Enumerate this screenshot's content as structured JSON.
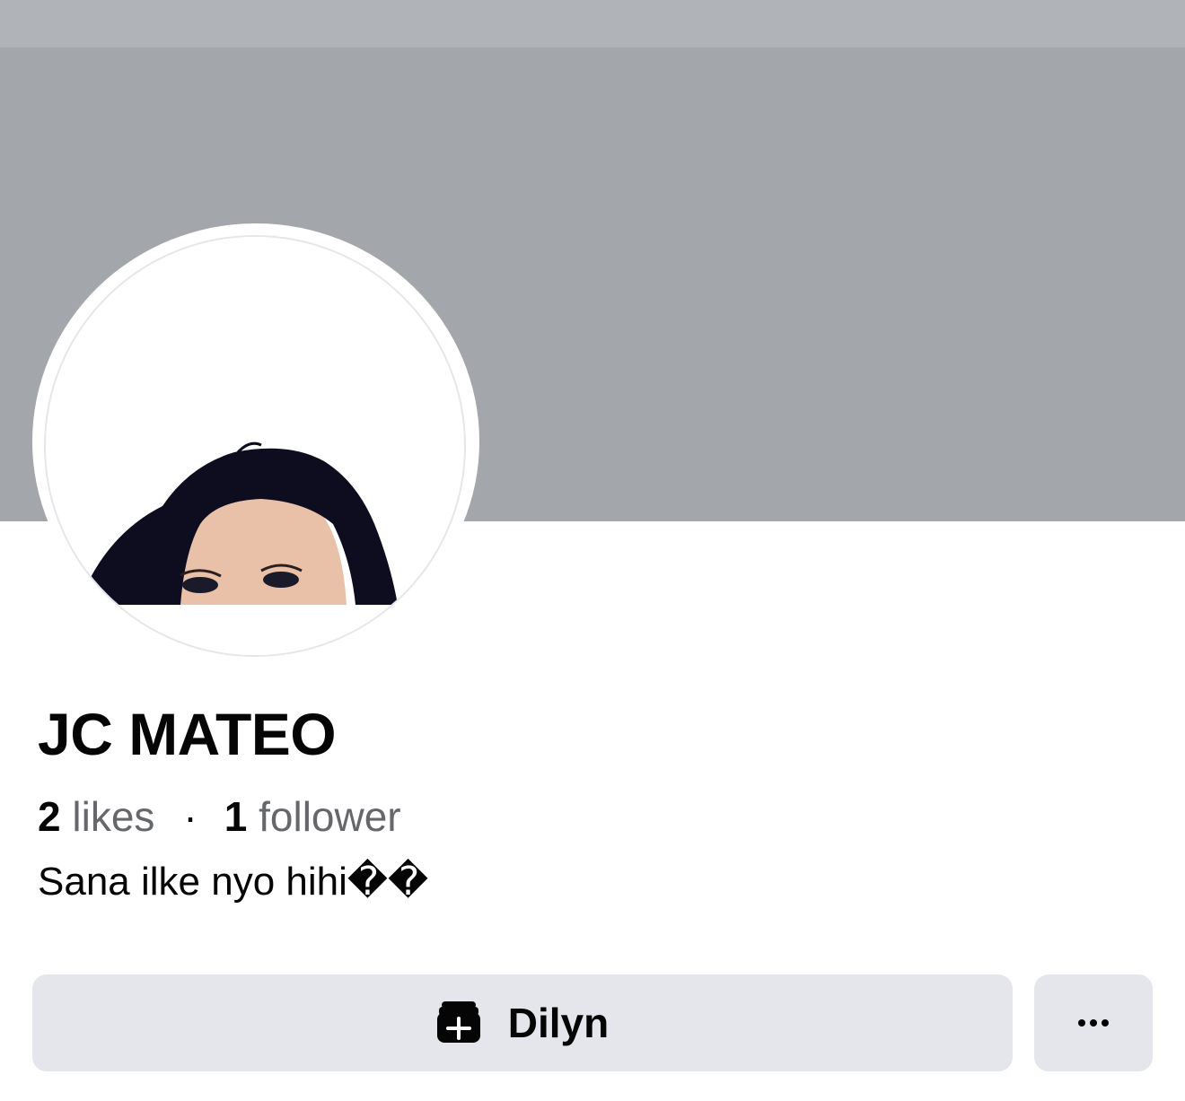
{
  "profile": {
    "name": "JC MATEO",
    "likes_count": "2",
    "likes_label": "likes",
    "separator": "·",
    "followers_count": "1",
    "followers_label": "follower",
    "bio": "Sana ilke nyo hihi��"
  },
  "actions": {
    "like_label": "Dilyn",
    "like_icon": "like-page-icon",
    "more_label": "···",
    "more_icon": "more-icon"
  },
  "colors": {
    "cover": "#a3a6aa",
    "topbar": "#b0b3b8",
    "button_bg": "#e4e6eb",
    "secondary_text": "#65676b",
    "primary_text": "#050505"
  }
}
